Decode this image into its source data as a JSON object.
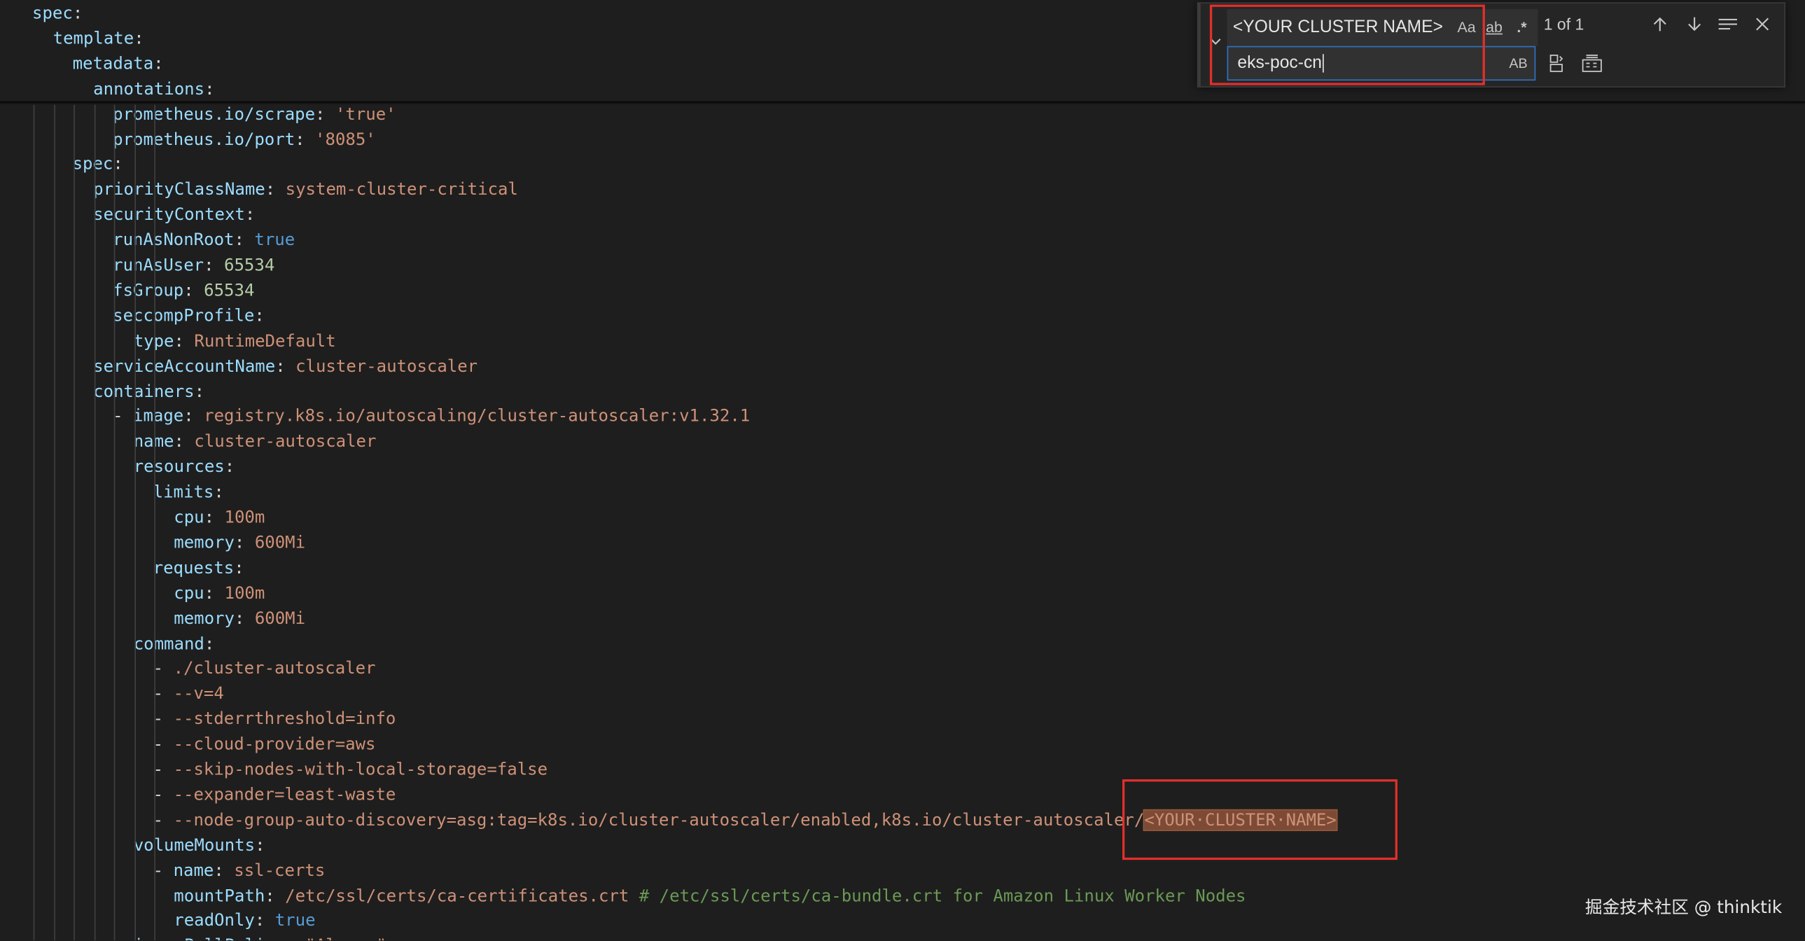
{
  "editor": {
    "lines": [
      [
        {
          "t": "spec",
          "c": "k"
        },
        {
          "t": ":",
          "c": "p"
        }
      ],
      [
        {
          "t": "template",
          "c": "k"
        },
        {
          "t": ":",
          "c": "p"
        }
      ],
      [
        {
          "t": "metadata",
          "c": "k"
        },
        {
          "t": ":",
          "c": "p"
        }
      ],
      [
        {
          "t": "annotations",
          "c": "k"
        },
        {
          "t": ":",
          "c": "p"
        }
      ],
      [
        {
          "t": "prometheus.io/scrape",
          "c": "k"
        },
        {
          "t": ": ",
          "c": "p"
        },
        {
          "t": "'true'",
          "c": "s"
        }
      ],
      [
        {
          "t": "prometheus.io/port",
          "c": "k"
        },
        {
          "t": ": ",
          "c": "p"
        },
        {
          "t": "'8085'",
          "c": "s"
        }
      ],
      [
        {
          "t": "spec",
          "c": "k"
        },
        {
          "t": ":",
          "c": "p"
        }
      ],
      [
        {
          "t": "priorityClassName",
          "c": "k"
        },
        {
          "t": ": ",
          "c": "p"
        },
        {
          "t": "system-cluster-critical",
          "c": "s"
        }
      ],
      [
        {
          "t": "securityContext",
          "c": "k"
        },
        {
          "t": ":",
          "c": "p"
        }
      ],
      [
        {
          "t": "runAsNonRoot",
          "c": "k"
        },
        {
          "t": ": ",
          "c": "p"
        },
        {
          "t": "true",
          "c": "b"
        }
      ],
      [
        {
          "t": "runAsUser",
          "c": "k"
        },
        {
          "t": ": ",
          "c": "p"
        },
        {
          "t": "65534",
          "c": "n"
        }
      ],
      [
        {
          "t": "fsGroup",
          "c": "k"
        },
        {
          "t": ": ",
          "c": "p"
        },
        {
          "t": "65534",
          "c": "n"
        }
      ],
      [
        {
          "t": "seccompProfile",
          "c": "k"
        },
        {
          "t": ":",
          "c": "p"
        }
      ],
      [
        {
          "t": "type",
          "c": "k"
        },
        {
          "t": ": ",
          "c": "p"
        },
        {
          "t": "RuntimeDefault",
          "c": "s"
        }
      ],
      [
        {
          "t": "serviceAccountName",
          "c": "k"
        },
        {
          "t": ": ",
          "c": "p"
        },
        {
          "t": "cluster-autoscaler",
          "c": "s"
        }
      ],
      [
        {
          "t": "containers",
          "c": "k"
        },
        {
          "t": ":",
          "c": "p"
        }
      ],
      [
        {
          "t": "- ",
          "c": "p"
        },
        {
          "t": "image",
          "c": "k"
        },
        {
          "t": ": ",
          "c": "p"
        },
        {
          "t": "registry.k8s.io/autoscaling/cluster-autoscaler:v1.32.1",
          "c": "s"
        }
      ],
      [
        {
          "t": "name",
          "c": "k"
        },
        {
          "t": ": ",
          "c": "p"
        },
        {
          "t": "cluster-autoscaler",
          "c": "s"
        }
      ],
      [
        {
          "t": "resources",
          "c": "k"
        },
        {
          "t": ":",
          "c": "p"
        }
      ],
      [
        {
          "t": "limits",
          "c": "k"
        },
        {
          "t": ":",
          "c": "p"
        }
      ],
      [
        {
          "t": "cpu",
          "c": "k"
        },
        {
          "t": ": ",
          "c": "p"
        },
        {
          "t": "100m",
          "c": "s"
        }
      ],
      [
        {
          "t": "memory",
          "c": "k"
        },
        {
          "t": ": ",
          "c": "p"
        },
        {
          "t": "600Mi",
          "c": "s"
        }
      ],
      [
        {
          "t": "requests",
          "c": "k"
        },
        {
          "t": ":",
          "c": "p"
        }
      ],
      [
        {
          "t": "cpu",
          "c": "k"
        },
        {
          "t": ": ",
          "c": "p"
        },
        {
          "t": "100m",
          "c": "s"
        }
      ],
      [
        {
          "t": "memory",
          "c": "k"
        },
        {
          "t": ": ",
          "c": "p"
        },
        {
          "t": "600Mi",
          "c": "s"
        }
      ],
      [
        {
          "t": "command",
          "c": "k"
        },
        {
          "t": ":",
          "c": "p"
        }
      ],
      [
        {
          "t": "- ",
          "c": "p"
        },
        {
          "t": "./cluster-autoscaler",
          "c": "s"
        }
      ],
      [
        {
          "t": "- ",
          "c": "p"
        },
        {
          "t": "--v=4",
          "c": "s"
        }
      ],
      [
        {
          "t": "- ",
          "c": "p"
        },
        {
          "t": "--stderrthreshold=info",
          "c": "s"
        }
      ],
      [
        {
          "t": "- ",
          "c": "p"
        },
        {
          "t": "--cloud-provider=aws",
          "c": "s"
        }
      ],
      [
        {
          "t": "- ",
          "c": "p"
        },
        {
          "t": "--skip-nodes-with-local-storage=false",
          "c": "s"
        }
      ],
      [
        {
          "t": "- ",
          "c": "p"
        },
        {
          "t": "--expander=least-waste",
          "c": "s"
        }
      ],
      [
        {
          "t": "- ",
          "c": "p"
        },
        {
          "t": "--node-group-auto-discovery=asg:tag=k8s.io/cluster-autoscaler/enabled,k8s.io/cluster-autoscaler/",
          "c": "s"
        },
        {
          "t": "<YOUR·CLUSTER·NAME>",
          "c": "match"
        }
      ],
      [
        {
          "t": "volumeMounts",
          "c": "k"
        },
        {
          "t": ":",
          "c": "p"
        }
      ],
      [
        {
          "t": "- ",
          "c": "p"
        },
        {
          "t": "name",
          "c": "k"
        },
        {
          "t": ": ",
          "c": "p"
        },
        {
          "t": "ssl-certs",
          "c": "s"
        }
      ],
      [
        {
          "t": "mountPath",
          "c": "k"
        },
        {
          "t": ": ",
          "c": "p"
        },
        {
          "t": "/etc/ssl/certs/ca-certificates.crt ",
          "c": "s"
        },
        {
          "t": "# /etc/ssl/certs/ca-bundle.crt for Amazon Linux Worker Nodes",
          "c": "c"
        }
      ],
      [
        {
          "t": "readOnly",
          "c": "k"
        },
        {
          "t": ": ",
          "c": "p"
        },
        {
          "t": "true",
          "c": "b"
        }
      ],
      [
        {
          "t": "imagePullPolicy",
          "c": "k"
        },
        {
          "t": ": ",
          "c": "p"
        },
        {
          "t": "\"Always\"",
          "c": "s"
        }
      ]
    ]
  },
  "find_widget": {
    "find_value": "<YOUR CLUSTER NAME>",
    "match_case_label": "Aa",
    "whole_word_label": "ab",
    "regex_label": ".*",
    "match_count": "1 of 1",
    "replace_value": "eks-poc-cn",
    "preserve_case_label": "AB"
  },
  "watermark": "掘金技术社区 @ thinktik",
  "icons": {
    "toggle_replace": "chevron-down-icon",
    "previous_match": "arrow-up-icon",
    "next_match": "arrow-down-icon",
    "find_in_selection": "selection-lines-icon",
    "close": "close-icon",
    "replace_one": "replace-icon",
    "replace_all": "replace-all-icon"
  },
  "colors": {
    "editor_bg": "#1e1e1e",
    "yaml_key": "#9cdcfe",
    "yaml_string": "#ce9178",
    "yaml_number": "#b5cea8",
    "yaml_boolean": "#569cd6",
    "comment": "#6a9955",
    "match_highlight": "#7d4b35",
    "annotation_box": "#e0302a",
    "input_focus": "#2f73c7"
  }
}
